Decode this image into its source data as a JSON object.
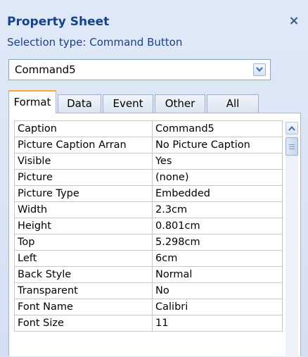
{
  "panel": {
    "title": "Property Sheet",
    "close_glyph": "×",
    "selection_type": "Selection type:  Command Button"
  },
  "object_selector": {
    "value": "Command5"
  },
  "tabs": [
    {
      "label": "Format",
      "active": true
    },
    {
      "label": "Data",
      "active": false
    },
    {
      "label": "Event",
      "active": false
    },
    {
      "label": "Other",
      "active": false
    },
    {
      "label": "All",
      "active": false
    }
  ],
  "properties": [
    {
      "name": "Caption",
      "value": "Command5"
    },
    {
      "name": "Picture Caption Arran",
      "value": "No Picture Caption"
    },
    {
      "name": "Visible",
      "value": "Yes"
    },
    {
      "name": "Picture",
      "value": "(none)"
    },
    {
      "name": "Picture Type",
      "value": "Embedded"
    },
    {
      "name": "Width",
      "value": "2.3cm"
    },
    {
      "name": "Height",
      "value": "0.801cm"
    },
    {
      "name": "Top",
      "value": "5.298cm"
    },
    {
      "name": "Left",
      "value": "6cm"
    },
    {
      "name": "Back Style",
      "value": "Normal"
    },
    {
      "name": "Transparent",
      "value": "No"
    },
    {
      "name": "Font Name",
      "value": "Calibri"
    },
    {
      "name": "Font Size",
      "value": "11"
    }
  ],
  "icons": {
    "close": "close-icon",
    "dropdown": "chevron-down-icon",
    "scroll_up": "chevron-up-icon"
  },
  "colors": {
    "title": "#15428b",
    "panel_bg": "#dbe6f5",
    "active_tab_accent": "#f5a941"
  }
}
